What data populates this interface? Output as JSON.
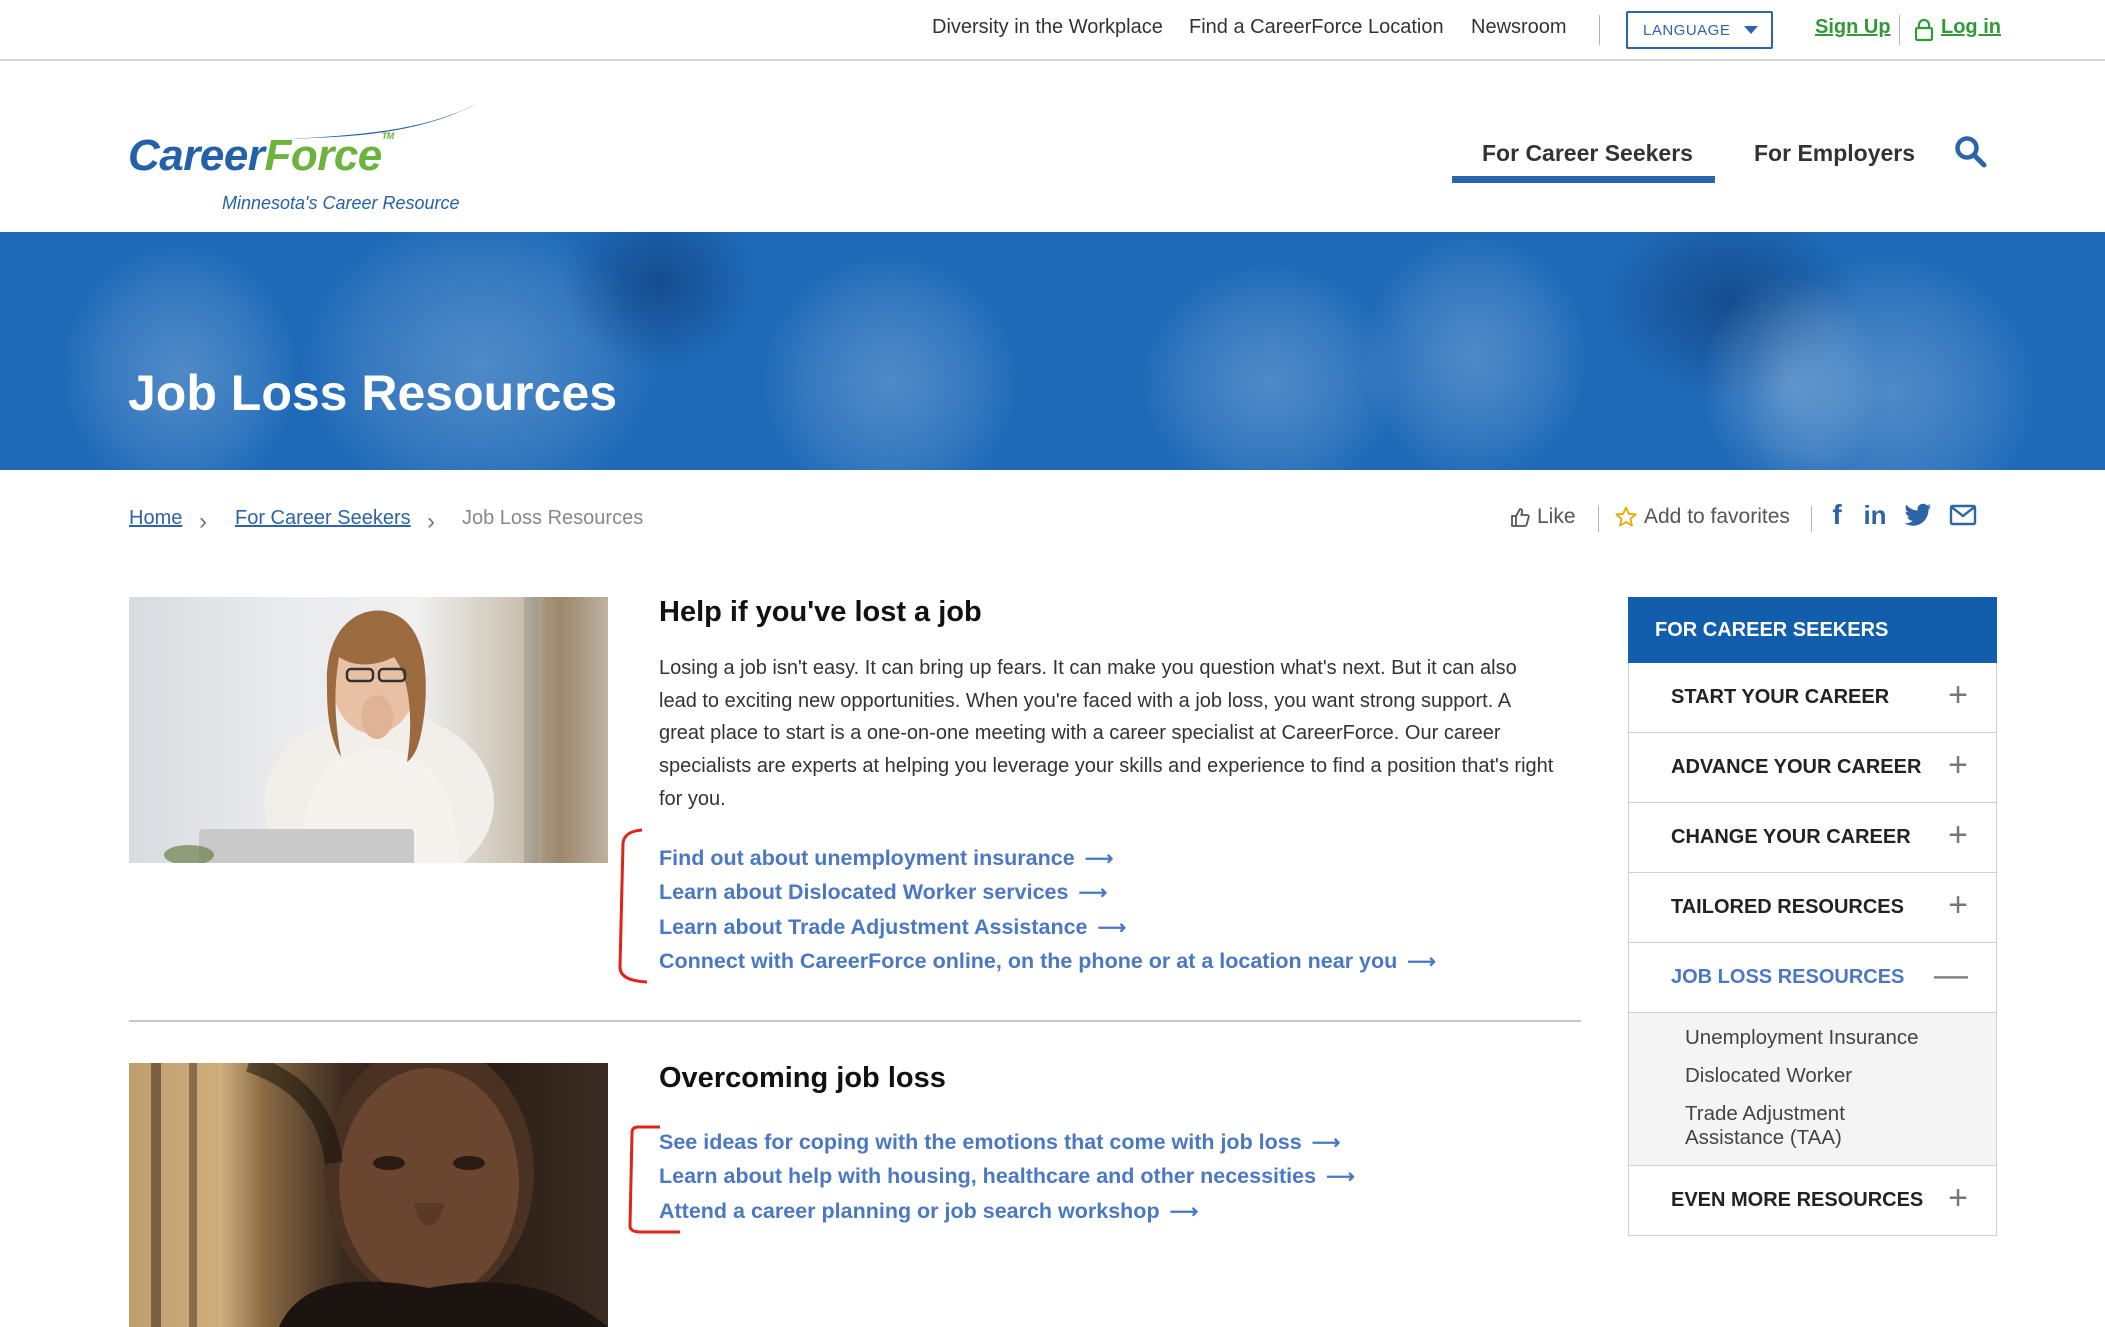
{
  "utility_nav": {
    "diversity": "Diversity in the Workplace",
    "find_location": "Find a CareerForce Location",
    "newsroom": "Newsroom",
    "language": "LANGUAGE",
    "sign_up": "Sign Up",
    "log_in": "Log in"
  },
  "logo": {
    "career": "Career",
    "force": "Force",
    "tm": "TM",
    "tagline": "Minnesota's Career Resource"
  },
  "main_nav": {
    "career_seekers": "For Career Seekers",
    "employers": "For Employers"
  },
  "hero": {
    "title": "Job Loss Resources"
  },
  "breadcrumb": {
    "home": "Home",
    "career_seekers": "For Career Seekers",
    "current": "Job Loss Resources"
  },
  "share": {
    "like": "Like",
    "favorites": "Add to favorites"
  },
  "section1": {
    "title": "Help if you've lost a job",
    "body": "Losing a job isn't easy. It can bring up fears. It can make you question what's next. But it can also lead to exciting new opportunities. When you're faced with a job loss, you want strong support. A great place to start is a one-on-one meeting with a career specialist at CareerForce. Our career specialists are experts at helping you leverage your skills and experience to find a position that's right for you.",
    "links": [
      "Find out about unemployment insurance",
      "Learn about Dislocated Worker services",
      "Learn about Trade Adjustment Assistance",
      "Connect with CareerForce online, on the phone or at a location near you"
    ]
  },
  "section2": {
    "title": "Overcoming job loss",
    "links": [
      "See ideas for coping with the emotions that come with job loss",
      "Learn about help with housing, healthcare and other necessities",
      "Attend a career planning or job search workshop"
    ]
  },
  "sidebar": {
    "heading": "FOR CAREER SEEKERS",
    "items": [
      {
        "label": "START YOUR CAREER",
        "toggle": "+"
      },
      {
        "label": "ADVANCE YOUR CAREER",
        "toggle": "+"
      },
      {
        "label": "CHANGE YOUR CAREER",
        "toggle": "+"
      },
      {
        "label": "TAILORED RESOURCES",
        "toggle": "+"
      },
      {
        "label": "JOB LOSS RESOURCES",
        "toggle": "—"
      },
      {
        "label": "EVEN MORE RESOURCES",
        "toggle": "+"
      }
    ],
    "sub_items": [
      "Unemployment Insurance",
      "Dislocated Worker",
      "Trade Adjustment Assistance (TAA)"
    ]
  },
  "icons": {
    "lock": "lock-icon",
    "search": "search-icon",
    "like": "thumbs-up-icon",
    "favorite": "star-icon",
    "facebook": "facebook-icon",
    "linkedin": "linkedin-icon",
    "twitter": "twitter-icon",
    "email": "email-icon",
    "arrow": "right-arrow-icon",
    "chevron": "chevron-right-icon"
  },
  "colors": {
    "brand_blue": "#2461a8",
    "brand_green": "#6cb33f",
    "link_blue": "#4a78c4",
    "hero_blue": "#1f6ab8",
    "sidebar_head": "#135eac",
    "signup_green": "#2f9a36",
    "annotation_red": "#e0241b"
  }
}
